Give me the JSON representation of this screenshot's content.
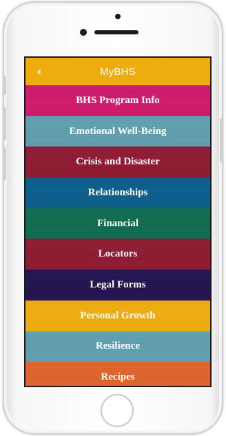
{
  "header": {
    "title": "MyBHS",
    "back_icon": "chevron-left-icon",
    "color": "#efac0f"
  },
  "menu": [
    {
      "label": "BHS Program Info",
      "color": "#d0196b"
    },
    {
      "label": "Emotional Well-Being",
      "color": "#5f9eaf"
    },
    {
      "label": "Crisis and Disaster",
      "color": "#8e1a32"
    },
    {
      "label": "Relationships",
      "color": "#0a5d8c"
    },
    {
      "label": "Financial",
      "color": "#0f6b50"
    },
    {
      "label": "Locators",
      "color": "#8e1a32"
    },
    {
      "label": "Legal Forms",
      "color": "#23124f"
    },
    {
      "label": "Personal Growth",
      "color": "#efac0f"
    },
    {
      "label": "Resilience",
      "color": "#5f9eaf"
    },
    {
      "label": "Recipes",
      "color": "#e0632a"
    }
  ]
}
